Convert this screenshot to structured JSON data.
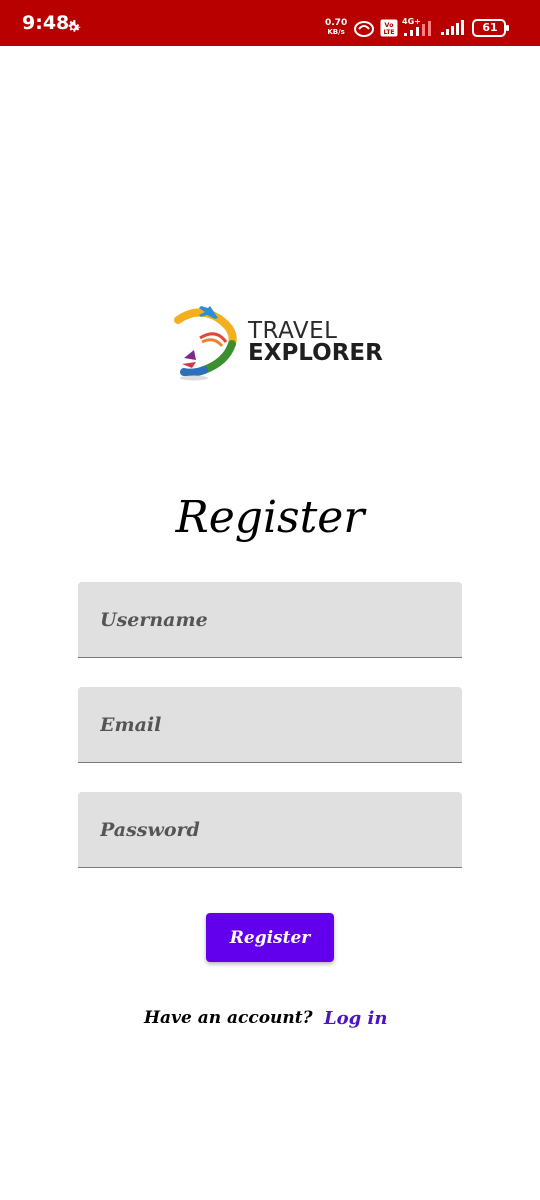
{
  "status_bar": {
    "time": "9:48",
    "net_speed_value": "0.70",
    "net_speed_unit": "KB/s",
    "network_type": "4G+",
    "volte_label": "Vo LTE",
    "battery": "61",
    "background_color": "#b80000",
    "icons": [
      "gear-icon",
      "sync-icon",
      "volte-icon",
      "signal-icon",
      "signal-icon",
      "battery-icon"
    ]
  },
  "logo": {
    "line1": "TRAVEL",
    "line2": "EXPLORER"
  },
  "form": {
    "title": "Register",
    "username_placeholder": "Username",
    "username_value": "",
    "email_placeholder": "Email",
    "email_value": "",
    "password_placeholder": "Password",
    "password_value": "",
    "field_background": "#e0e0e0"
  },
  "actions": {
    "register_label": "Register",
    "register_color": "#6200ee",
    "have_account_text": "Have an account?",
    "login_label": "Log in",
    "login_color": "#4a14c8"
  }
}
